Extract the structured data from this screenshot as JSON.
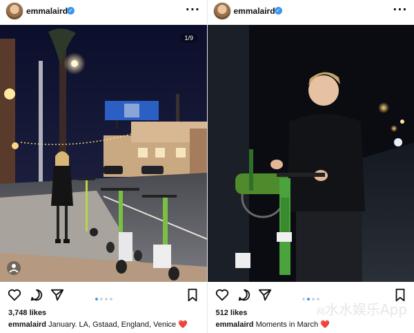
{
  "posts": [
    {
      "username": "emmalaird",
      "photo_counter": "1/9",
      "likes": "3,748 likes",
      "caption_user": "emmalaird",
      "caption_text": "January. LA, Gstaad, England, Venice",
      "caption_emoji": "❤️",
      "carousel_active_index": 0,
      "carousel_total_dots": 4
    },
    {
      "username": "emmalaird",
      "likes": "512 likes",
      "caption_user": "emmalaird",
      "caption_text": "Moments in March",
      "caption_emoji": "❤️",
      "carousel_active_index": 1,
      "carousel_total_dots": 4
    }
  ],
  "icons": {
    "more": "more-options-icon",
    "verified": "verified-badge-icon",
    "like": "heart-outline-icon",
    "comment": "comment-icon",
    "share": "send-icon",
    "save": "bookmark-icon"
  },
  "watermark": {
    "prefix": "网",
    "text": "水水娱乐App"
  },
  "colors": {
    "verified": "#3897f0",
    "dot_active": "#3897f0",
    "heart": "#e0245e"
  }
}
